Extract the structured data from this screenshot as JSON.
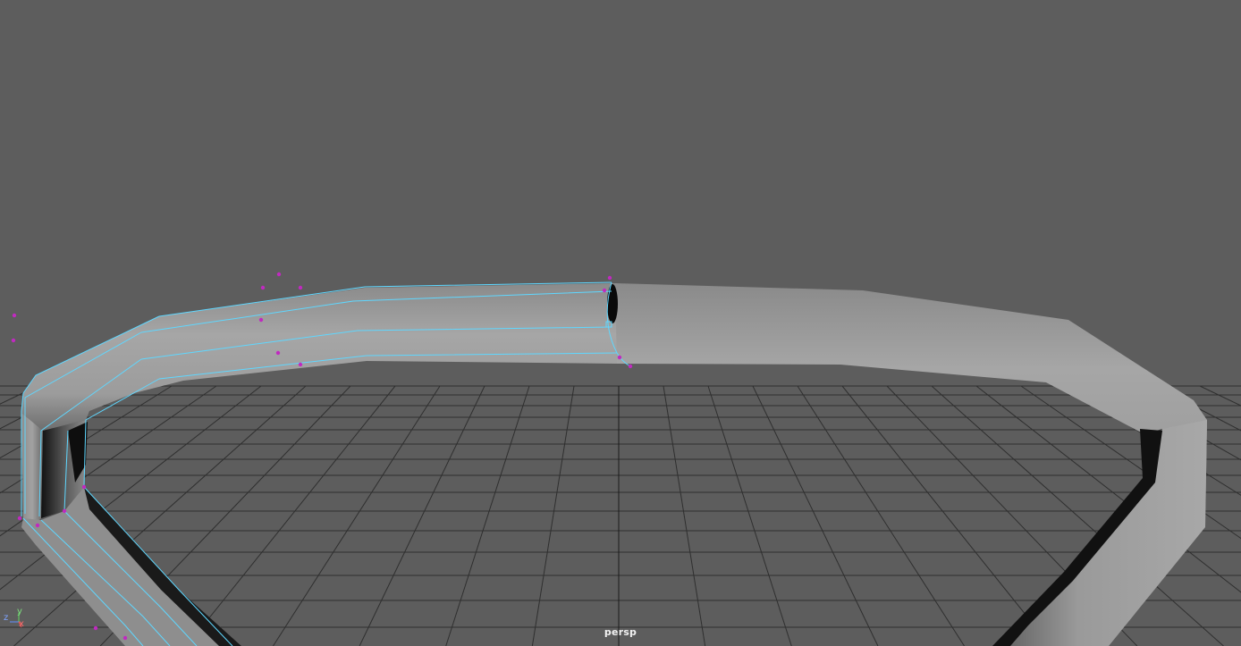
{
  "viewport": {
    "camera_name": "persp",
    "background_color": "#5d5d5d",
    "grid_color": "#2f2f2f",
    "grid_axis_color": "#1a1a1a",
    "selection_color": "#5fd7ff",
    "point_color": "#c02ac0",
    "mesh_color": "#9a9a9a"
  },
  "axis_gizmo": {
    "x_label": "x",
    "y_label": "y",
    "z_label": "z",
    "x_color": "#ff5050",
    "y_color": "#5fd75f",
    "z_color": "#5f8fff"
  }
}
